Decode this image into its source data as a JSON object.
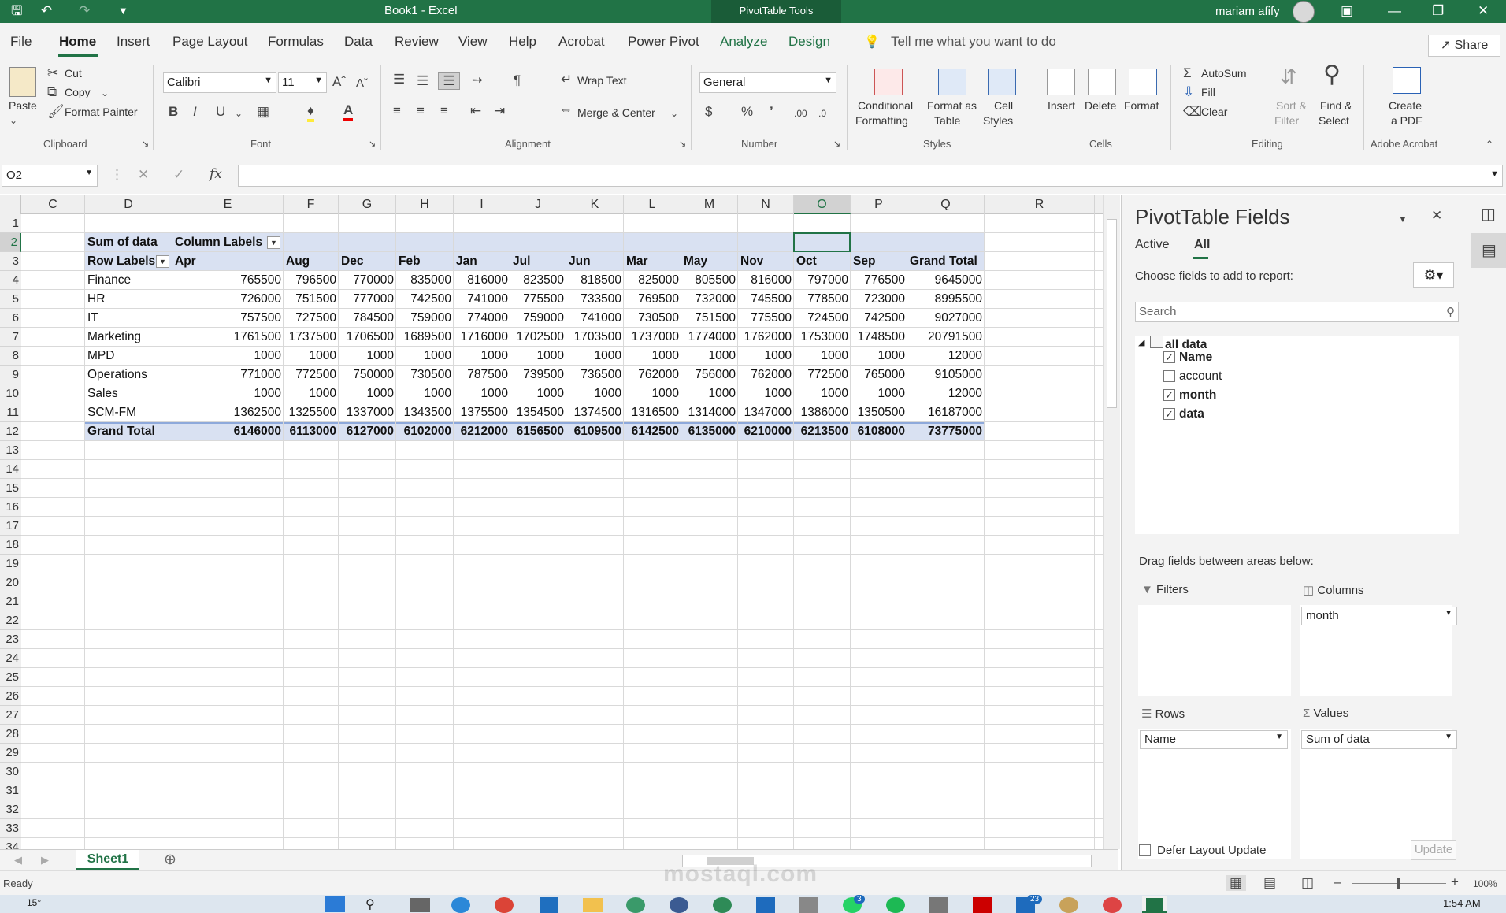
{
  "app": {
    "document_title": "Book1  -  Excel",
    "contextual_tab": "PivotTable Tools",
    "user_name": "mariam afify",
    "share_label": "Share"
  },
  "menu": [
    "File",
    "Home",
    "Insert",
    "Page Layout",
    "Formulas",
    "Data",
    "Review",
    "View",
    "Help",
    "Acrobat",
    "Power Pivot",
    "Analyze",
    "Design"
  ],
  "tell_me": "Tell me what you want to do",
  "ribbon": {
    "clipboard": {
      "paste": "Paste",
      "cut": "Cut",
      "copy": "Copy",
      "format_painter": "Format Painter",
      "group": "Clipboard"
    },
    "font": {
      "name": "Calibri",
      "size": "11",
      "group": "Font",
      "bold": "B",
      "italic": "I",
      "underline": "U"
    },
    "alignment": {
      "wrap": "Wrap Text",
      "merge": "Merge & Center",
      "group": "Alignment"
    },
    "number": {
      "format": "General",
      "group": "Number",
      "currency": "$",
      "percent": "%",
      "comma": "ʼ",
      "inc_dec": ".00",
      "dec_dec": ".0"
    },
    "styles": {
      "cond1": "Conditional",
      "cond2": "Formatting",
      "fmt1": "Format as",
      "fmt2": "Table",
      "cell1": "Cell",
      "cell2": "Styles",
      "group": "Styles"
    },
    "cells": {
      "insert": "Insert",
      "delete": "Delete",
      "format": "Format",
      "group": "Cells"
    },
    "editing": {
      "autosum": "AutoSum",
      "fill": "Fill",
      "clear": "Clear",
      "sort1": "Sort &",
      "sort2": "Filter",
      "find1": "Find &",
      "find2": "Select",
      "group": "Editing"
    },
    "acrobat": {
      "create1": "Create",
      "create2": "a PDF",
      "group": "Adobe Acrobat"
    }
  },
  "formula_bar": {
    "name_box": "O2",
    "fx": "fx",
    "value": ""
  },
  "columns": [
    "C",
    "D",
    "E",
    "F",
    "G",
    "H",
    "I",
    "J",
    "K",
    "L",
    "M",
    "N",
    "O",
    "P",
    "Q",
    "R"
  ],
  "rows": [
    "1",
    "2",
    "3",
    "4",
    "5",
    "6",
    "7",
    "8",
    "9",
    "10",
    "11",
    "12",
    "13",
    "14",
    "15",
    "16",
    "17",
    "18",
    "19",
    "20",
    "21",
    "22",
    "23",
    "24",
    "25",
    "26",
    "27",
    "28",
    "29",
    "30",
    "31",
    "32",
    "33",
    "34"
  ],
  "pivot": {
    "sum_label": "Sum of data",
    "column_labels": "Column Labels",
    "row_labels": "Row Labels",
    "months": [
      "Apr",
      "Aug",
      "Dec",
      "Feb",
      "Jan",
      "Jul",
      "Jun",
      "Mar",
      "May",
      "Nov",
      "Oct",
      "Sep",
      "Grand Total"
    ],
    "data": [
      {
        "name": "Finance",
        "values": [
          "765500",
          "796500",
          "770000",
          "835000",
          "816000",
          "823500",
          "818500",
          "825000",
          "805500",
          "816000",
          "797000",
          "776500",
          "9645000"
        ]
      },
      {
        "name": "HR",
        "values": [
          "726000",
          "751500",
          "777000",
          "742500",
          "741000",
          "775500",
          "733500",
          "769500",
          "732000",
          "745500",
          "778500",
          "723000",
          "8995500"
        ]
      },
      {
        "name": "IT",
        "values": [
          "757500",
          "727500",
          "784500",
          "759000",
          "774000",
          "759000",
          "741000",
          "730500",
          "751500",
          "775500",
          "724500",
          "742500",
          "9027000"
        ]
      },
      {
        "name": "Marketing",
        "values": [
          "1761500",
          "1737500",
          "1706500",
          "1689500",
          "1716000",
          "1702500",
          "1703500",
          "1737000",
          "1774000",
          "1762000",
          "1753000",
          "1748500",
          "20791500"
        ]
      },
      {
        "name": "MPD",
        "values": [
          "1000",
          "1000",
          "1000",
          "1000",
          "1000",
          "1000",
          "1000",
          "1000",
          "1000",
          "1000",
          "1000",
          "1000",
          "12000"
        ]
      },
      {
        "name": "Operations",
        "values": [
          "771000",
          "772500",
          "750000",
          "730500",
          "787500",
          "739500",
          "736500",
          "762000",
          "756000",
          "762000",
          "772500",
          "765000",
          "9105000"
        ]
      },
      {
        "name": "Sales",
        "values": [
          "1000",
          "1000",
          "1000",
          "1000",
          "1000",
          "1000",
          "1000",
          "1000",
          "1000",
          "1000",
          "1000",
          "1000",
          "12000"
        ]
      },
      {
        "name": "SCM-FM",
        "values": [
          "1362500",
          "1325500",
          "1337000",
          "1343500",
          "1375500",
          "1354500",
          "1374500",
          "1316500",
          "1314000",
          "1347000",
          "1386000",
          "1350500",
          "16187000"
        ]
      }
    ],
    "grand_total": {
      "name": "Grand Total",
      "values": [
        "6146000",
        "6113000",
        "6127000",
        "6102000",
        "6212000",
        "6156500",
        "6109500",
        "6142500",
        "6135000",
        "6210000",
        "6213500",
        "6108000",
        "73775000"
      ]
    }
  },
  "pane": {
    "title": "PivotTable Fields",
    "tab_active": "Active",
    "tab_all": "All",
    "choose": "Choose fields to add to report:",
    "search_placeholder": "Search",
    "table_name": "all data",
    "fields": [
      {
        "name": "Name",
        "checked": true
      },
      {
        "name": "account",
        "checked": false
      },
      {
        "name": "month",
        "checked": true
      },
      {
        "name": "data",
        "checked": true
      }
    ],
    "drag_label": "Drag fields between areas below:",
    "filters": "Filters",
    "columns": "Columns",
    "rows": "Rows",
    "values": "Values",
    "columns_item": "month",
    "rows_item": "Name",
    "values_item": "Sum of data",
    "defer": "Defer Layout Update",
    "update": "Update"
  },
  "sheet_tab": "Sheet1",
  "status": {
    "ready": "Ready",
    "zoom": "100%"
  },
  "taskbar": {
    "temp": "15°",
    "time": "1:54 AM",
    "badge1": "3",
    "badge2": "23"
  },
  "watermark": "mostaql.com"
}
